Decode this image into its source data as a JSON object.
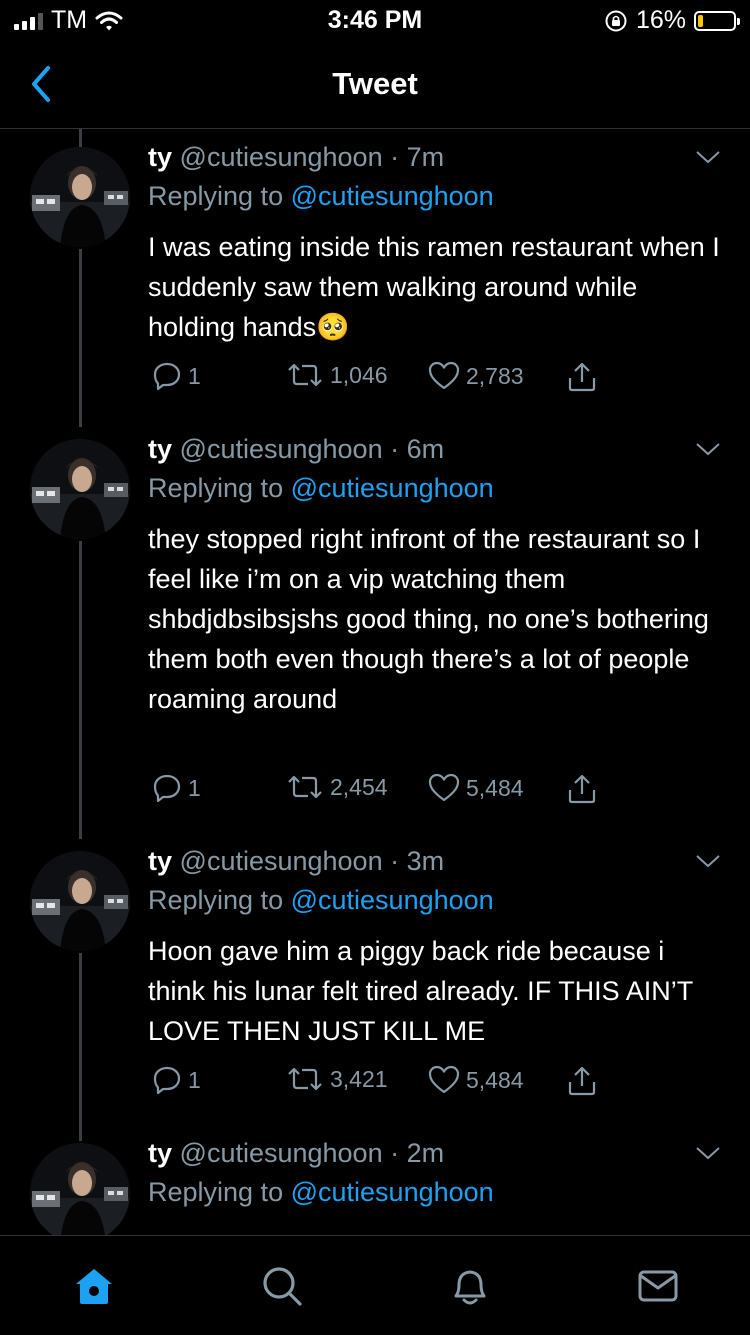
{
  "status": {
    "carrier": "TM",
    "time": "3:46 PM",
    "battery": "16%",
    "battery_level": 0.16
  },
  "header": {
    "title": "Tweet",
    "back_icon": "chevron-left-icon"
  },
  "tweets": [
    {
      "name": "ty",
      "handle": "@cutiesunghoon",
      "dot": "·",
      "time": "7m",
      "replying_prefix": "Replying to",
      "replying_to": "@cutiesunghoon",
      "text": "I was eating inside this ramen restaurant when I suddenly saw them walking around while holding hands🥺",
      "replies": "1",
      "retweets": "1,046",
      "likes": "2,783"
    },
    {
      "name": "ty",
      "handle": "@cutiesunghoon",
      "dot": "·",
      "time": "6m",
      "replying_prefix": "Replying to",
      "replying_to": "@cutiesunghoon",
      "text": "they stopped right infront of the restaurant so I feel like i’m on a vip watching them shbdjdbsibsjshs good thing, no one’s bothering them both even though there’s a lot of people roaming around",
      "replies": "1",
      "retweets": "2,454",
      "likes": "5,484"
    },
    {
      "name": "ty",
      "handle": "@cutiesunghoon",
      "dot": "·",
      "time": "3m",
      "replying_prefix": "Replying to",
      "replying_to": "@cutiesunghoon",
      "text": "Hoon gave him a piggy back ride because i think his lunar felt tired already. IF THIS AIN’T LOVE THEN JUST KILL ME",
      "replies": "1",
      "retweets": "3,421",
      "likes": "5,484"
    },
    {
      "name": "ty",
      "handle": "@cutiesunghoon",
      "dot": "·",
      "time": "2m",
      "replying_prefix": "Replying to",
      "replying_to": "@cutiesunghoon"
    }
  ],
  "tabs": [
    {
      "icon": "home-icon",
      "active": true
    },
    {
      "icon": "search-icon",
      "active": false
    },
    {
      "icon": "bell-icon",
      "active": false
    },
    {
      "icon": "mail-icon",
      "active": false
    }
  ],
  "colors": {
    "background": "#000000",
    "accent": "#1da1f2",
    "secondary_text": "#8899a6",
    "battery": "#f6c700"
  }
}
